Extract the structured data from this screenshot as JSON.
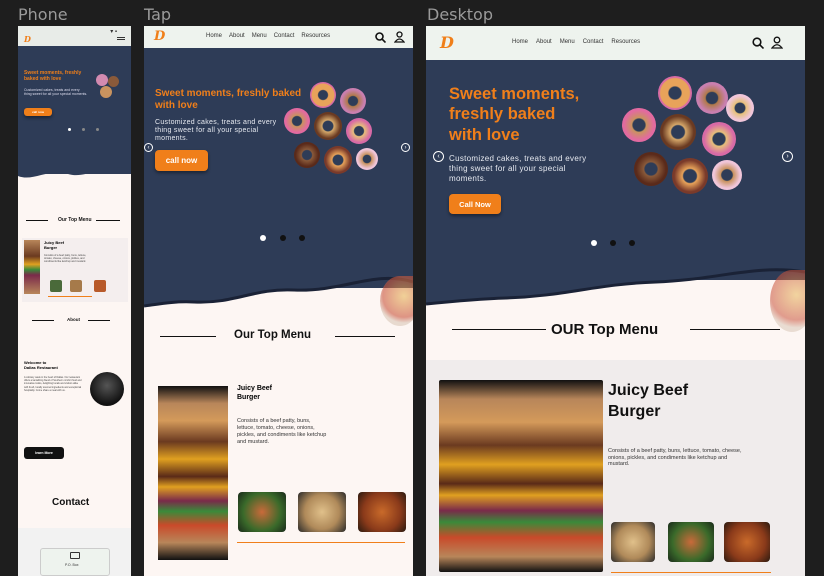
{
  "frames": {
    "phone": {
      "label": "Phone"
    },
    "tap": {
      "label": "Tap"
    },
    "desktop": {
      "label": "Desktop"
    }
  },
  "nav": {
    "items": [
      "Home",
      "About",
      "Menu",
      "Contact",
      "Resources"
    ]
  },
  "hero": {
    "title_short": "Sweet moments, freshly baked with love",
    "title_desktop_1": "Sweet moments,",
    "title_desktop_2": "freshly baked",
    "title_desktop_3": "with love",
    "subtitle": "Customized cakes, treats and every thing sweet for all your special moments.",
    "cta_tap": "call now",
    "cta_desktop": "Call Now"
  },
  "menu": {
    "title_tap": "Our Top Menu",
    "title_desktop": "OUR Top Menu",
    "title_phone": "Our Top Menu",
    "item_name": "Juicy Beef Burger",
    "item_desc": "Consists of a beef patty, buns, lettuce, tomato, cheese, onions, pickles, and condiments like ketchup and mustard."
  },
  "about": {
    "title": "About",
    "welcome_1": "Welcome to",
    "welcome_2": "Dallas Restaurant",
    "body": "A culinary oasis in the heart of Dallas. Our restaurant offers a tantalizing blend of Southern comfort food and innovative twists, delighting locals and visitors alike with fresh, locally sourced ingredients and exceptional hospitality. Come share a meal with us.",
    "learn_more": "learn More"
  },
  "contact": {
    "title": "Contact",
    "po_box": "P.O. Box"
  },
  "colors": {
    "hero_bg": "#2e3c57",
    "accent": "#f07f1a",
    "header_bg": "#eef3ee",
    "page_bg": "#fdf6f3"
  },
  "icons": [
    "search-icon",
    "user-icon",
    "chevron-left-icon",
    "chevron-right-icon",
    "chat-icon",
    "logo-mark"
  ]
}
